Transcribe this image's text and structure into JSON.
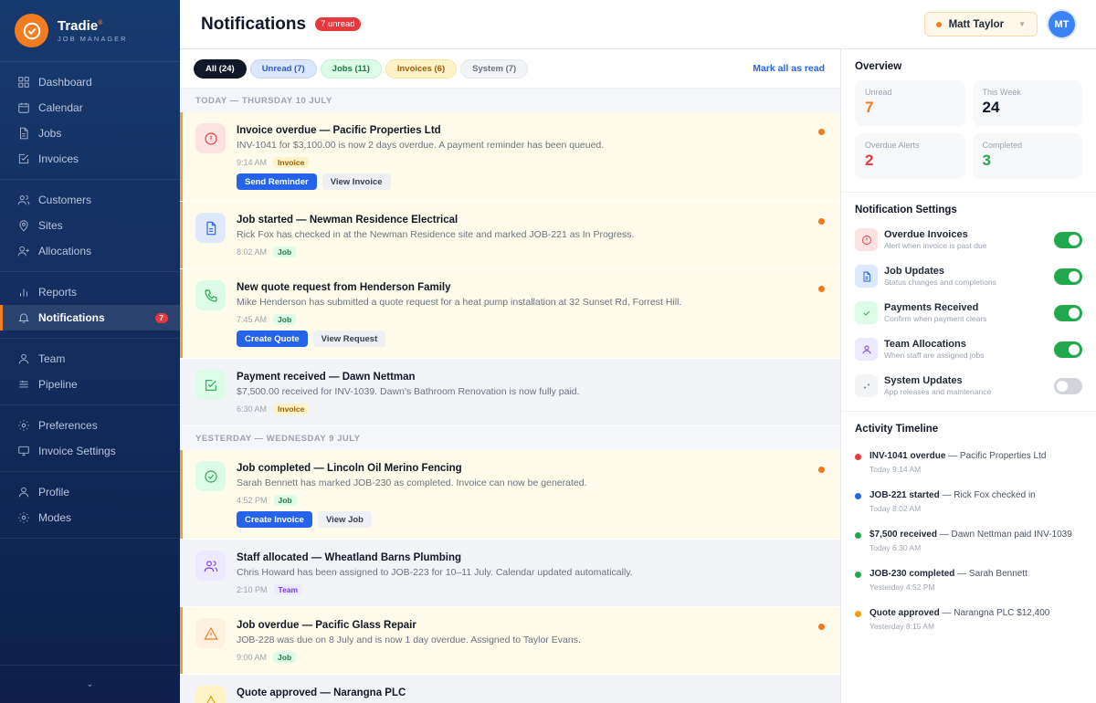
{
  "brand": {
    "name": "Tradie",
    "mark": "®",
    "sub": "JOB MANAGER"
  },
  "nav": [
    [
      {
        "label": "Dashboard",
        "icon": "grid"
      },
      {
        "label": "Calendar",
        "icon": "calendar"
      },
      {
        "label": "Jobs",
        "icon": "file"
      },
      {
        "label": "Invoices",
        "icon": "check-square"
      }
    ],
    [
      {
        "label": "Customers",
        "icon": "users"
      },
      {
        "label": "Sites",
        "icon": "pin"
      },
      {
        "label": "Allocations",
        "icon": "user-plus"
      }
    ],
    [
      {
        "label": "Reports",
        "icon": "bar"
      },
      {
        "label": "Notifications",
        "icon": "bell",
        "active": true,
        "badge": "7"
      }
    ],
    [
      {
        "label": "Team",
        "icon": "user"
      },
      {
        "label": "Pipeline",
        "icon": "layers"
      }
    ],
    [
      {
        "label": "Preferences",
        "icon": "sun"
      },
      {
        "label": "Invoice Settings",
        "icon": "monitor"
      }
    ],
    [
      {
        "label": "Profile",
        "icon": "user"
      },
      {
        "label": "Modes",
        "icon": "sun"
      }
    ]
  ],
  "collapse_icon": "⌄",
  "header": {
    "title": "Notifications",
    "unread": "7 unread",
    "user": "Matt Taylor",
    "avatar": "MT"
  },
  "filters": [
    {
      "label": "All (24)",
      "bg": "#111827",
      "fg": "#ffffff",
      "bd": "#111827"
    },
    {
      "label": "Unread (7)",
      "bg": "#dbe7fd",
      "fg": "#3158c9",
      "bd": "#c3d5fb"
    },
    {
      "label": "Jobs (11)",
      "bg": "#dcfce7",
      "fg": "#1f7a3f",
      "bd": "#c5f1d3"
    },
    {
      "label": "Invoices (6)",
      "bg": "#fef3c7",
      "fg": "#a15c07",
      "bd": "#fbe3a0"
    },
    {
      "label": "System (7)",
      "bg": "#f3f4f6",
      "fg": "#6b7280",
      "bd": "#e5e7eb"
    }
  ],
  "mark_all": "Mark all as read",
  "sections": [
    {
      "label": "TODAY — THURSDAY 10 JULY",
      "items": [
        {
          "title": "Invoice overdue — Pacific Properties Ltd",
          "desc": "INV-1041 for $3,100.00 is now 2 days overdue. A payment reminder has been queued.",
          "time": "9:14 AM",
          "tag": "Invoice",
          "unread": true,
          "icon": "alert",
          "actions": [
            "Send Reminder",
            "View Invoice"
          ]
        },
        {
          "title": "Job started — Newman Residence Electrical",
          "desc": "Rick Fox has checked in at the Newman Residence site and marked JOB-221 as In Progress.",
          "time": "8:02 AM",
          "tag": "Job",
          "unread": true,
          "icon": "file",
          "actions": []
        },
        {
          "title": "New quote request from Henderson Family",
          "desc": "Mike Henderson has submitted a quote request for a heat pump installation at 32 Sunset Rd, Forrest Hill.",
          "time": "7:45 AM",
          "tag": "Job",
          "unread": true,
          "icon": "phone",
          "actions": [
            "Create Quote",
            "View Request"
          ]
        },
        {
          "title": "Payment received — Dawn Nettman",
          "desc": "$7,500.00 received for INV-1039. Dawn's Bathroom Renovation is now fully paid.",
          "time": "6:30 AM",
          "tag": "Invoice",
          "unread": false,
          "icon": "check-square",
          "actions": []
        }
      ]
    },
    {
      "label": "YESTERDAY — WEDNESDAY 9 JULY",
      "items": [
        {
          "title": "Job completed — Lincoln Oil Merino Fencing",
          "desc": "Sarah Bennett has marked JOB-230 as completed. Invoice can now be generated.",
          "time": "4:52 PM",
          "tag": "Job",
          "unread": true,
          "icon": "check-circle",
          "actions": [
            "Create Invoice",
            "View Job"
          ]
        },
        {
          "title": "Staff allocated — Wheatland Barns Plumbing",
          "desc": "Chris Howard has been assigned to JOB-223 for 10–11 July. Calendar updated automatically.",
          "time": "2:10 PM",
          "tag": "Team",
          "unread": false,
          "icon": "users",
          "actions": []
        },
        {
          "title": "Job overdue — Pacific Glass Repair",
          "desc": "JOB-228 was due on 8 July and is now 1 day overdue. Assigned to Taylor Evans.",
          "time": "9:00 AM",
          "tag": "Job",
          "unread": true,
          "icon": "warning",
          "actions": []
        },
        {
          "title": "Quote approved — Narangna PLC",
          "desc": "",
          "time": "",
          "tag": "",
          "unread": false,
          "icon": "star",
          "actions": []
        }
      ]
    }
  ],
  "overview": {
    "title": "Overview",
    "stats": [
      {
        "label": "Unread",
        "value": "7",
        "color": "#f07a1e"
      },
      {
        "label": "This Week",
        "value": "24",
        "color": "#111827"
      },
      {
        "label": "Overdue Alerts",
        "value": "2",
        "color": "#e5393f"
      },
      {
        "label": "Completed",
        "value": "3",
        "color": "#22a94f"
      }
    ]
  },
  "settings": {
    "title": "Notification Settings",
    "items": [
      {
        "title": "Overdue Invoices",
        "desc": "Alert when invoice is past due",
        "icon": "alert",
        "on": true
      },
      {
        "title": "Job Updates",
        "desc": "Status changes and completions",
        "icon": "file",
        "on": true
      },
      {
        "title": "Payments Received",
        "desc": "Confirm when payment clears",
        "icon": "check",
        "on": true
      },
      {
        "title": "Team Allocations",
        "desc": "When staff are assigned jobs",
        "icon": "user",
        "on": true
      },
      {
        "title": "System Updates",
        "desc": "App releases and maintenance",
        "icon": "dots",
        "on": false
      }
    ]
  },
  "timeline": {
    "title": "Activity Timeline",
    "items": [
      {
        "bold": "INV-1041 overdue",
        "rest": " — Pacific Properties Ltd",
        "time": "Today 9:14 AM",
        "color": "#e5393f"
      },
      {
        "bold": "JOB-221 started",
        "rest": " — Rick Fox checked in",
        "time": "Today 8:02 AM",
        "color": "#2563eb"
      },
      {
        "bold": "$7,500 received",
        "rest": " — Dawn Nettman paid INV-1039",
        "time": "Today 6:30 AM",
        "color": "#22a94f"
      },
      {
        "bold": "JOB-230 completed",
        "rest": " — Sarah Bennett",
        "time": "Yesterday 4:52 PM",
        "color": "#22a94f"
      },
      {
        "bold": "Quote approved",
        "rest": " — Narangna PLC $12,400",
        "time": "Yesterday 8:15 AM",
        "color": "#f59e0b"
      }
    ]
  }
}
